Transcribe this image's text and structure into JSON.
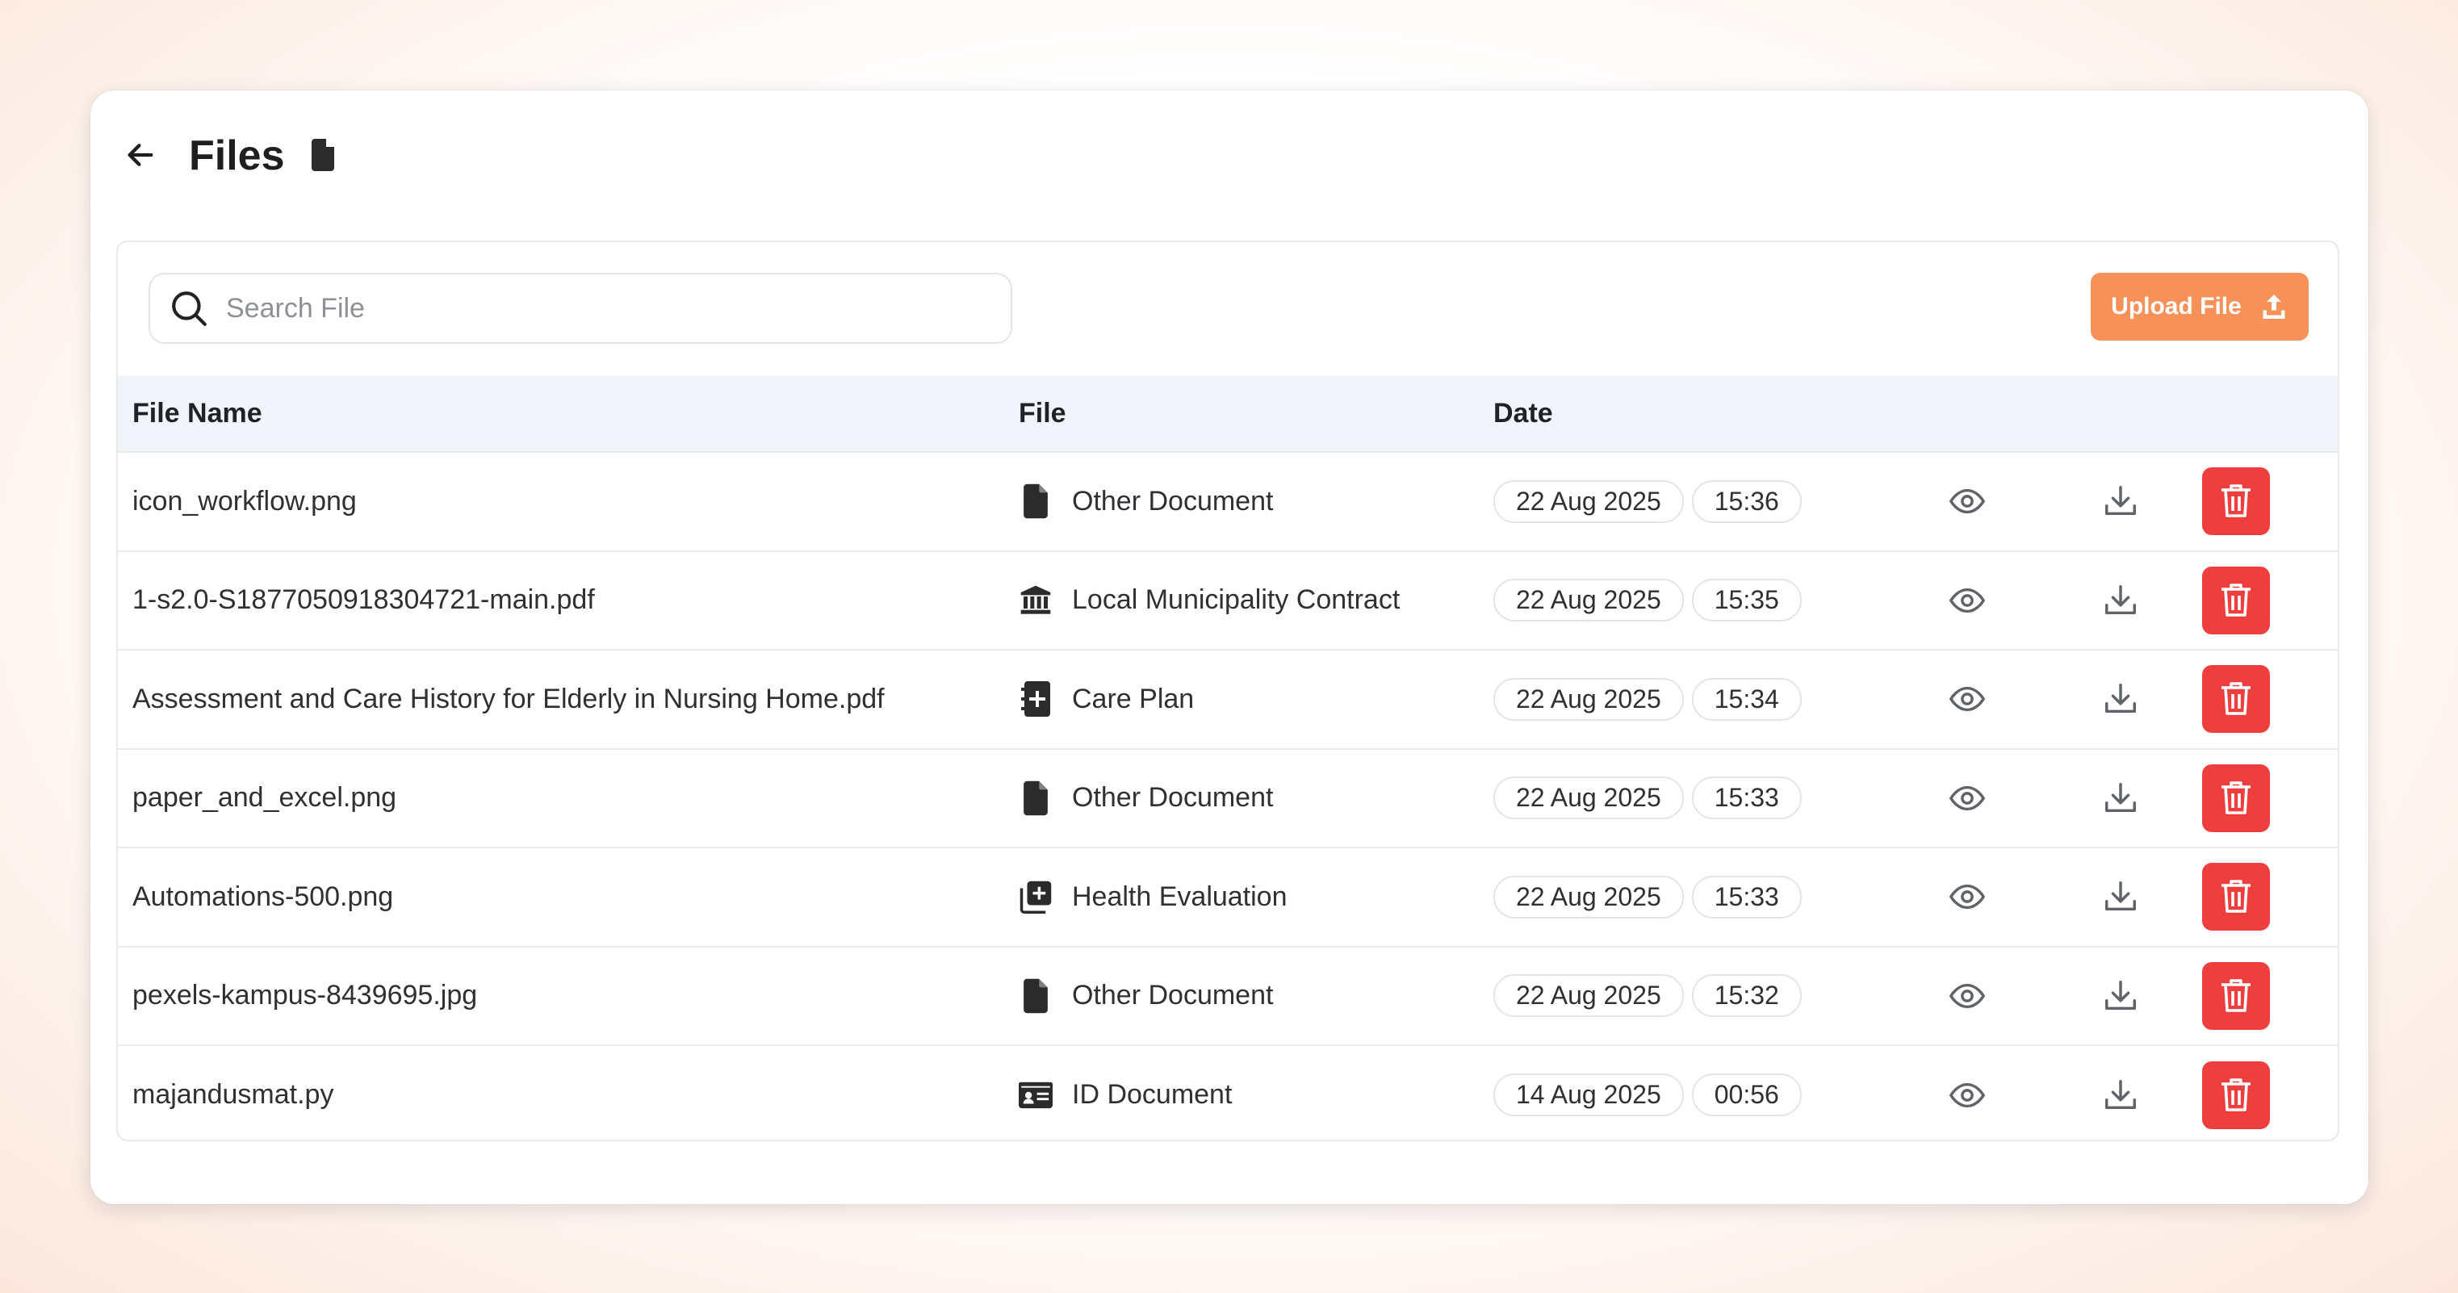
{
  "header": {
    "title": "Files",
    "back_icon": "arrow-left-icon",
    "title_icon": "file-icon"
  },
  "toolbar": {
    "search_placeholder": "Search File",
    "search_value": "",
    "upload_label": "Upload File"
  },
  "table": {
    "columns": [
      "File Name",
      "File",
      "Date"
    ],
    "rows": [
      {
        "name": "icon_workflow.png",
        "type": "Other Document",
        "type_icon": "file-icon",
        "date": "22 Aug 2025",
        "time": "15:36"
      },
      {
        "name": "1-s2.0-S1877050918304721-main.pdf",
        "type": "Local Municipality Contract",
        "type_icon": "bank-icon",
        "date": "22 Aug 2025",
        "time": "15:35"
      },
      {
        "name": "Assessment and Care History for Elderly in Nursing Home.pdf",
        "type": "Care Plan",
        "type_icon": "medical-book-icon",
        "date": "22 Aug 2025",
        "time": "15:34"
      },
      {
        "name": "paper_and_excel.png",
        "type": "Other Document",
        "type_icon": "file-icon",
        "date": "22 Aug 2025",
        "time": "15:33"
      },
      {
        "name": "Automations-500.png",
        "type": "Health Evaluation",
        "type_icon": "medical-copy-icon",
        "date": "22 Aug 2025",
        "time": "15:33"
      },
      {
        "name": "pexels-kampus-8439695.jpg",
        "type": "Other Document",
        "type_icon": "file-icon",
        "date": "22 Aug 2025",
        "time": "15:32"
      },
      {
        "name": "majandusmat.py",
        "type": "ID Document",
        "type_icon": "id-card-icon",
        "date": "14 Aug 2025",
        "time": "00:56"
      }
    ]
  },
  "colors": {
    "accent": "#f7915a",
    "danger": "#ef3e3e",
    "header_bg": "#f1f5f9"
  }
}
